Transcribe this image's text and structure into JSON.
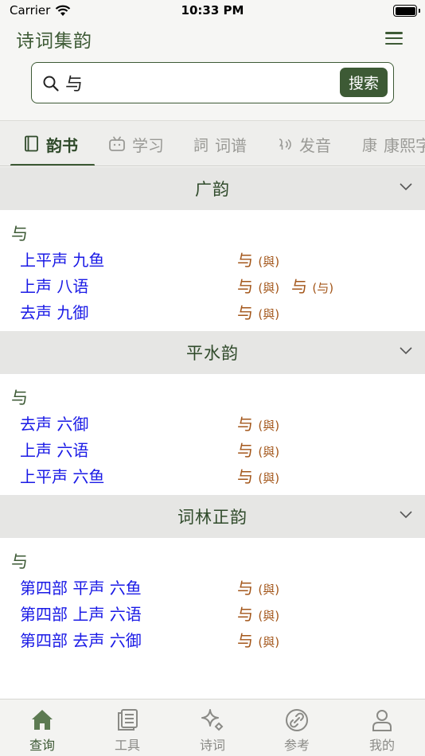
{
  "status": {
    "carrier": "Carrier",
    "time": "10:33 PM"
  },
  "header": {
    "title": "诗词集韵"
  },
  "search": {
    "value": "与",
    "button_label": "搜索"
  },
  "tabs": [
    {
      "label": "韵书",
      "glyph": "book-icon",
      "active": true
    },
    {
      "label": "学习",
      "glyph": "tv-icon"
    },
    {
      "label": "词谱",
      "glyph_text": "詞"
    },
    {
      "label": "发音",
      "glyph": "voice-icon"
    },
    {
      "label": "康熙字",
      "glyph_text": "康"
    }
  ],
  "sections": [
    {
      "title": "广韵",
      "head_char": "与",
      "rows": [
        {
          "rhyme": "上平声 九鱼",
          "variants": [
            {
              "char": "与",
              "trad": "(與)"
            }
          ]
        },
        {
          "rhyme": "上声 八语",
          "variants": [
            {
              "char": "与",
              "trad": "(與)"
            },
            {
              "char": "与",
              "trad": "(与)"
            }
          ]
        },
        {
          "rhyme": "去声 九御",
          "variants": [
            {
              "char": "与",
              "trad": "(與)"
            }
          ]
        }
      ]
    },
    {
      "title": "平水韵",
      "head_char": "与",
      "rows": [
        {
          "rhyme": "去声 六御",
          "variants": [
            {
              "char": "与",
              "trad": "(與)"
            }
          ]
        },
        {
          "rhyme": "上声 六语",
          "variants": [
            {
              "char": "与",
              "trad": "(與)"
            }
          ]
        },
        {
          "rhyme": "上平声 六鱼",
          "variants": [
            {
              "char": "与",
              "trad": "(與)"
            }
          ]
        }
      ]
    },
    {
      "title": "词林正韵",
      "head_char": "与",
      "rows": [
        {
          "rhyme": "第四部 平声 六鱼",
          "variants": [
            {
              "char": "与",
              "trad": "(與)"
            }
          ]
        },
        {
          "rhyme": "第四部 上声 六语",
          "variants": [
            {
              "char": "与",
              "trad": "(與)"
            }
          ]
        },
        {
          "rhyme": "第四部 去声 六御",
          "variants": [
            {
              "char": "与",
              "trad": "(與)"
            }
          ]
        }
      ]
    }
  ],
  "bottom_tabs": [
    {
      "label": "查询",
      "icon": "home-icon",
      "active": true
    },
    {
      "label": "工具",
      "icon": "document-icon"
    },
    {
      "label": "诗词",
      "icon": "sparkle-icon"
    },
    {
      "label": "参考",
      "icon": "link-icon"
    },
    {
      "label": "我的",
      "icon": "person-icon"
    }
  ],
  "colors": {
    "accent": "#3d5a35",
    "link": "#1a1ae6",
    "variant": "#a3561a"
  }
}
